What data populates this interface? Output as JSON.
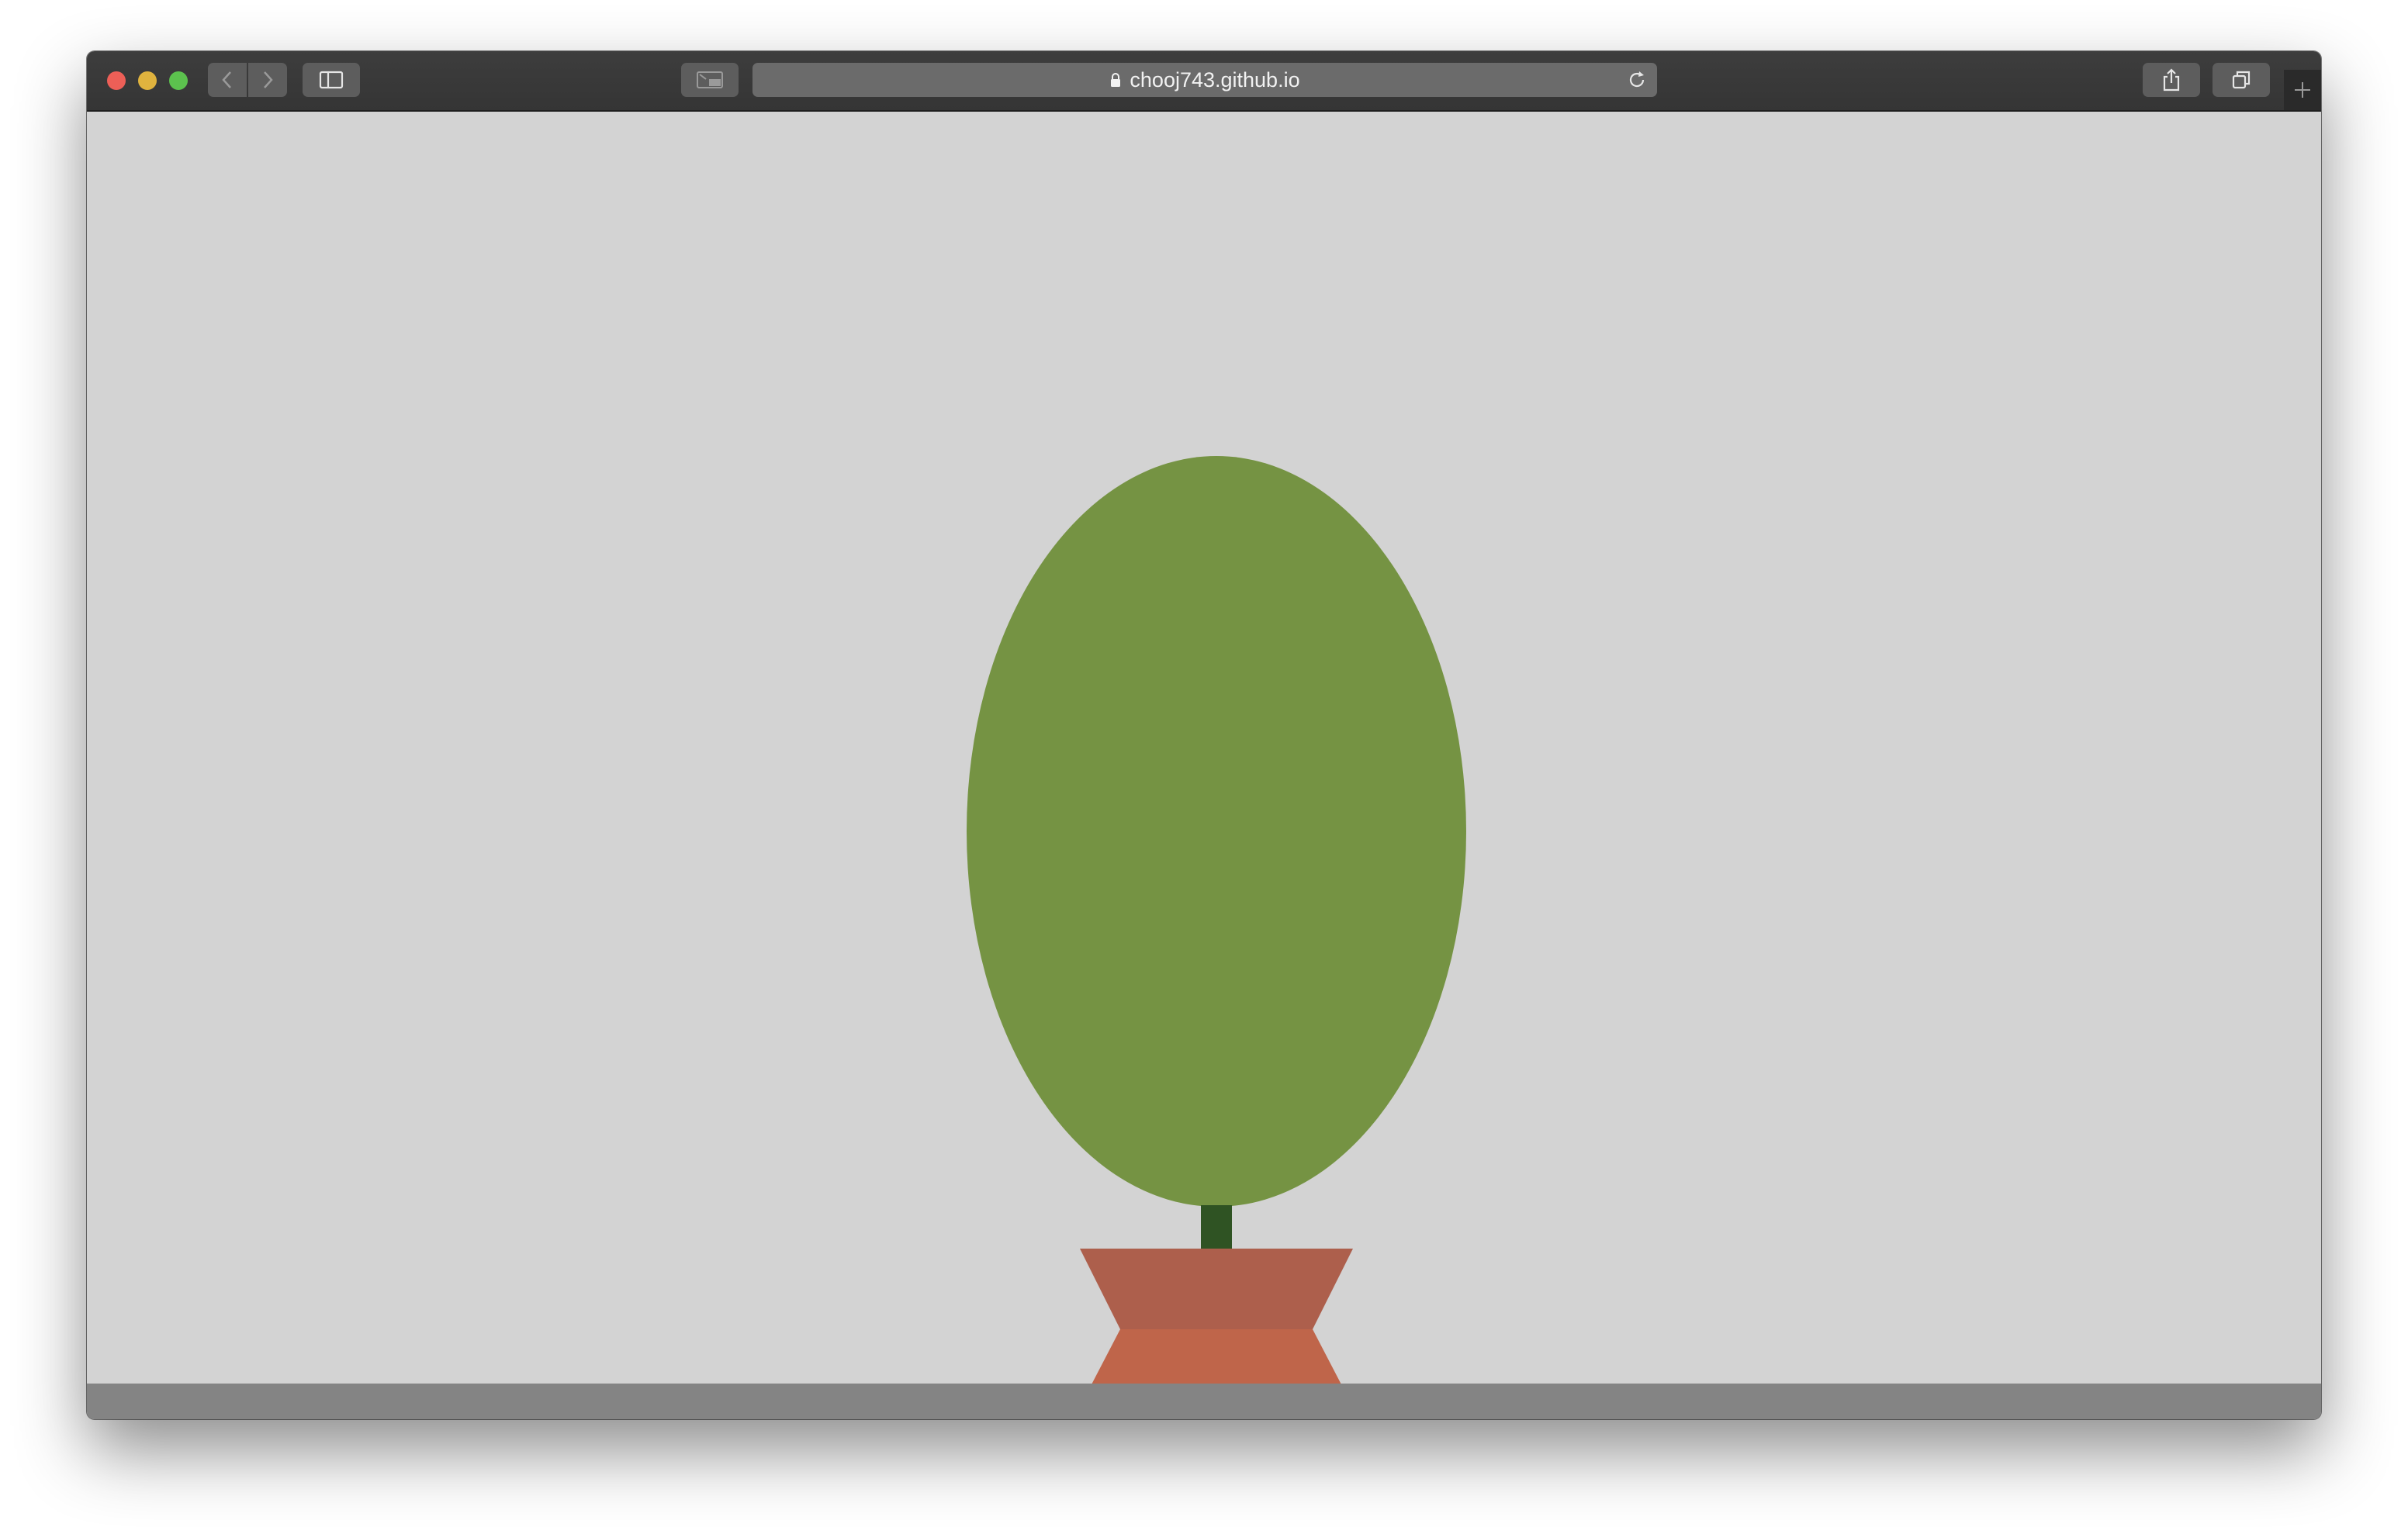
{
  "window": {
    "url": "chooj743.github.io"
  },
  "toolbar": {
    "icons": [
      "close-dot",
      "minimize-dot",
      "zoom-dot",
      "chevron-left-icon",
      "chevron-right-icon",
      "sidebar-icon",
      "picture-in-picture-icon",
      "lock-icon",
      "reload-icon",
      "share-icon",
      "tabs-overview-icon",
      "plus-icon"
    ]
  },
  "scene": {
    "background": "#d3d3d3",
    "floor_color": "#848484",
    "canopy_color": "#759343",
    "trunk_color": "#2f5323",
    "pot_dark_color": "#ad5f4c",
    "pot_light_color": "#bf654a"
  }
}
